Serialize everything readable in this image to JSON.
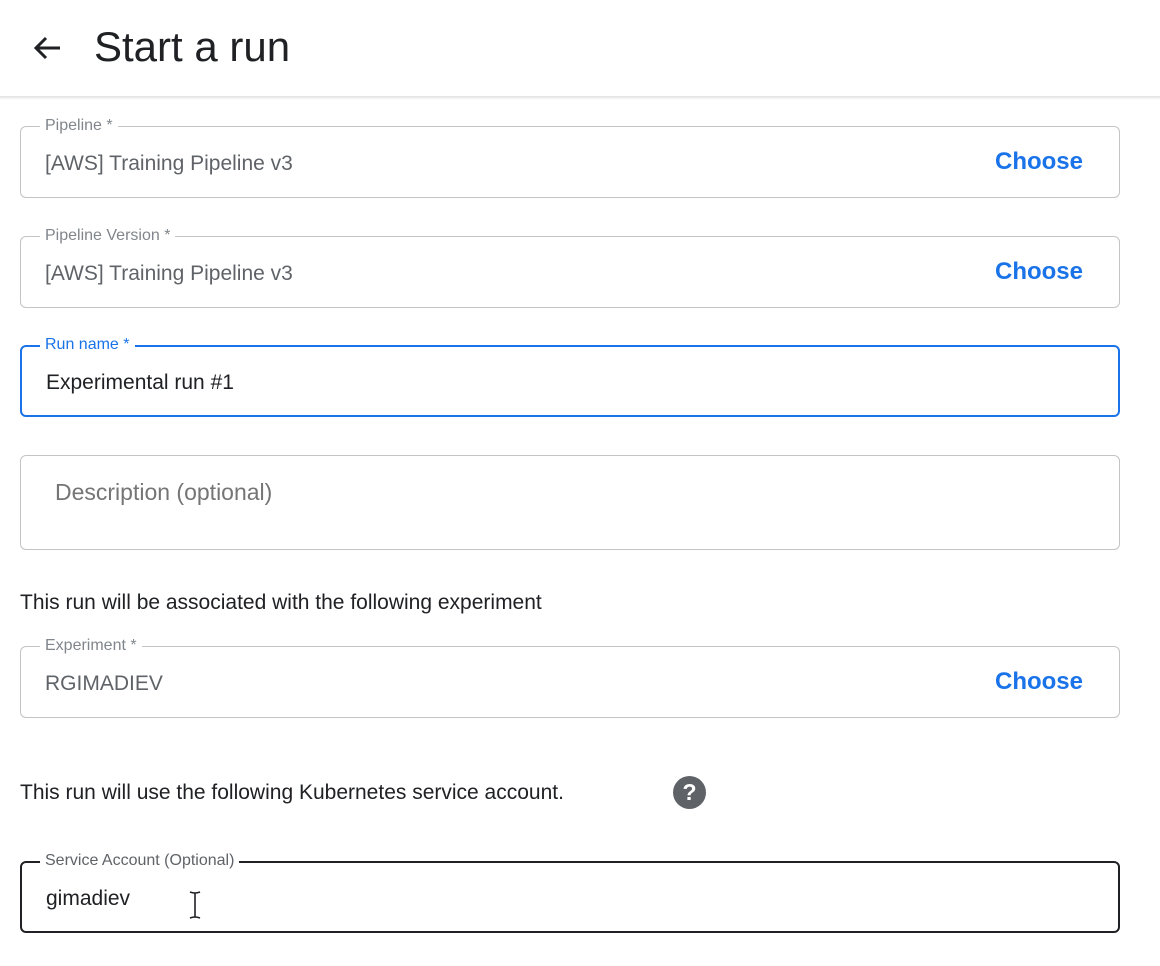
{
  "header": {
    "title": "Start a run",
    "back_icon": "arrow-left-icon"
  },
  "form": {
    "pipeline": {
      "label": "Pipeline *",
      "value": "[AWS] Training Pipeline v3",
      "action": "Choose"
    },
    "pipeline_version": {
      "label": "Pipeline Version *",
      "value": "[AWS] Training Pipeline v3",
      "action": "Choose"
    },
    "run_name": {
      "label": "Run name *",
      "value": "Experimental run #1"
    },
    "description": {
      "placeholder": "Description (optional)"
    },
    "experiment_info": "This run will be associated with the following experiment",
    "experiment": {
      "label": "Experiment *",
      "value": "RGIMADIEV",
      "action": "Choose"
    },
    "service_account_info": "This run will use the following Kubernetes service account.",
    "help_icon": {
      "name": "help-icon",
      "glyph": "?"
    },
    "service_account": {
      "label": "Service Account (Optional)",
      "value": "gimadiev"
    }
  },
  "colors": {
    "accent": "#1a73e8",
    "text": "#202124",
    "muted": "#5f6368",
    "border": "#c4c4c4"
  }
}
